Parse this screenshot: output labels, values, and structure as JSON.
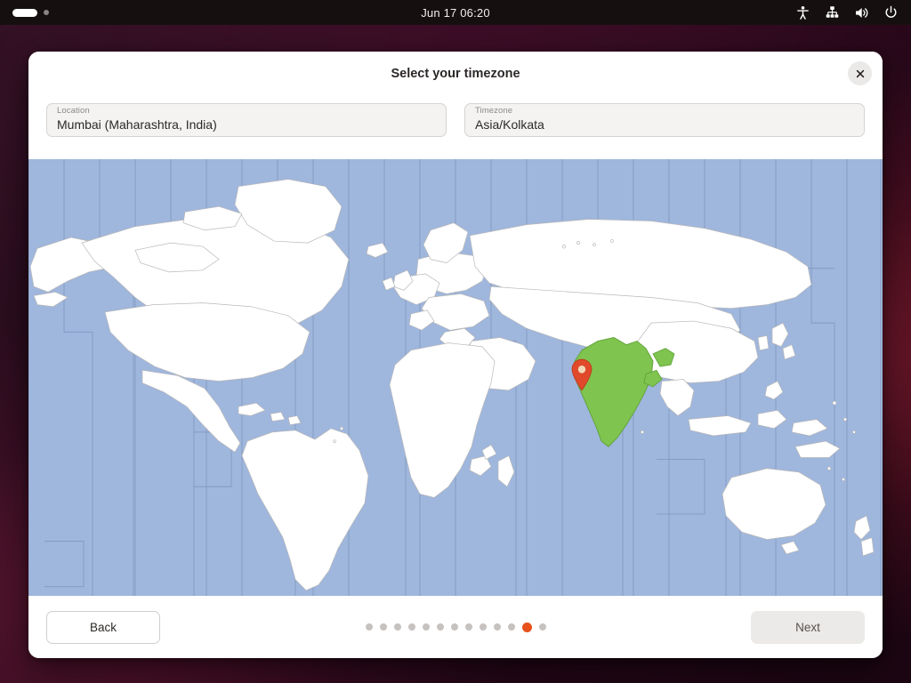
{
  "topbar": {
    "workspace_indicator": "active-workspace-pill",
    "clock": "Jun 17  06:20",
    "icons": [
      {
        "name": "accessibility-icon",
        "label": "Accessibility"
      },
      {
        "name": "network-wired-icon",
        "label": "Network"
      },
      {
        "name": "volume-icon",
        "label": "Volume"
      },
      {
        "name": "power-icon",
        "label": "Power"
      }
    ]
  },
  "dialog": {
    "title": "Select your timezone",
    "close_label": "×"
  },
  "fields": {
    "location": {
      "label": "Location",
      "value": "Mumbai (Maharashtra, India)",
      "placeholder": "Location"
    },
    "timezone": {
      "label": "Timezone",
      "value": "Asia/Kolkata",
      "placeholder": "Timezone"
    }
  },
  "map": {
    "ocean_color": "#9fb6dd",
    "land_color": "#ffffff",
    "border_color": "#8ba0c4",
    "highlight_country": "India",
    "highlight_color": "#7ec44f",
    "marker": {
      "name": "location-marker-pin",
      "city": "Mumbai",
      "color": "#e04a2a"
    }
  },
  "footer": {
    "back_label": "Back",
    "next_label": "Next",
    "progress": {
      "total_steps": 13,
      "current_step": 12,
      "active_color": "#e8511c",
      "inactive_color": "#c6c2bf"
    }
  }
}
